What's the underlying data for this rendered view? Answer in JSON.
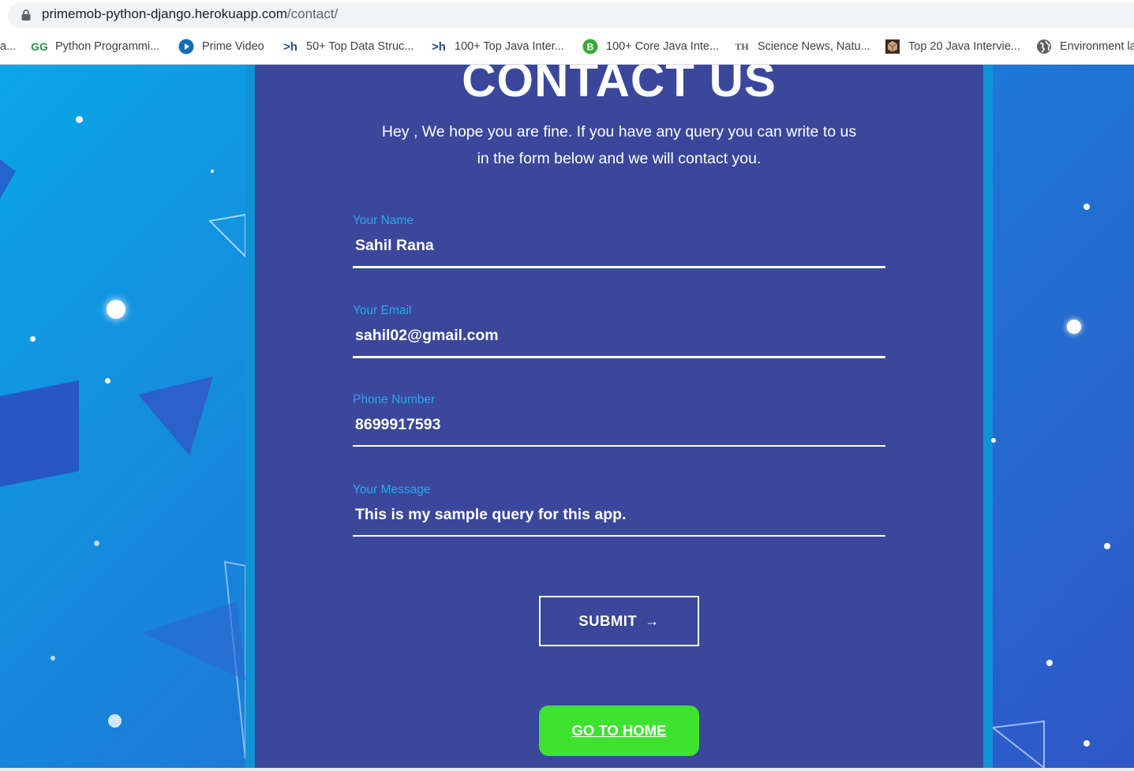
{
  "browser": {
    "url_host": "primemob-python-django.herokuapp.com",
    "url_path": "/contact/",
    "bookmarks": [
      {
        "label": "a...",
        "icon": "truncated-bookmark"
      },
      {
        "label": "Python Programmi...",
        "icon": "geeksforgeeks-icon"
      },
      {
        "label": "Prime Video",
        "icon": "prime-video-icon"
      },
      {
        "label": "50+ Top Data Struc...",
        "icon": "hackr-icon"
      },
      {
        "label": "100+ Top Java Inter...",
        "icon": "hackr-icon"
      },
      {
        "label": "100+ Core Java Inte...",
        "icon": "b-icon"
      },
      {
        "label": "Science News, Natu...",
        "icon": "th-icon"
      },
      {
        "label": "Top 20 Java Intervie...",
        "icon": "cube-icon"
      },
      {
        "label": "Environment la",
        "icon": "globe-icon"
      }
    ]
  },
  "page": {
    "heading": "CONTACT US",
    "intro_line1": "Hey , We hope you are fine. If you have any query you can write to us",
    "intro_line2": "in the form below and we will contact you.",
    "form": {
      "name_label": "Your Name",
      "name_value": "Sahil Rana",
      "email_label": "Your Email",
      "email_value": "sahil02@gmail.com",
      "phone_label": "Phone Number",
      "phone_value": "8699917593",
      "message_label": "Your Message",
      "message_value": "This is my sample query for this app."
    },
    "submit_label": "SUBMIT",
    "submit_arrow": "→",
    "home_label": "GO TO HOME"
  },
  "colors": {
    "panel": "#3a479b",
    "label_accent": "#29a7ee",
    "home_button": "#3ee32f"
  }
}
